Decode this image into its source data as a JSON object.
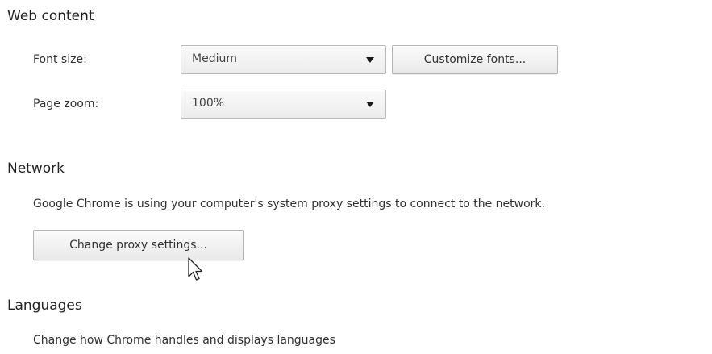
{
  "web_content": {
    "title": "Web content",
    "font_size": {
      "label": "Font size:",
      "selected": "Medium"
    },
    "customize_fonts_label": "Customize fonts...",
    "page_zoom": {
      "label": "Page zoom:",
      "selected": "100%"
    }
  },
  "network": {
    "title": "Network",
    "description": "Google Chrome is using your computer's system proxy settings to connect to the network.",
    "change_proxy_label": "Change proxy settings..."
  },
  "languages": {
    "title": "Languages",
    "description": "Change how Chrome handles and displays languages"
  },
  "icons": {
    "dropdown": "triangle-down-icon",
    "pointer": "mouse-pointer-icon"
  }
}
